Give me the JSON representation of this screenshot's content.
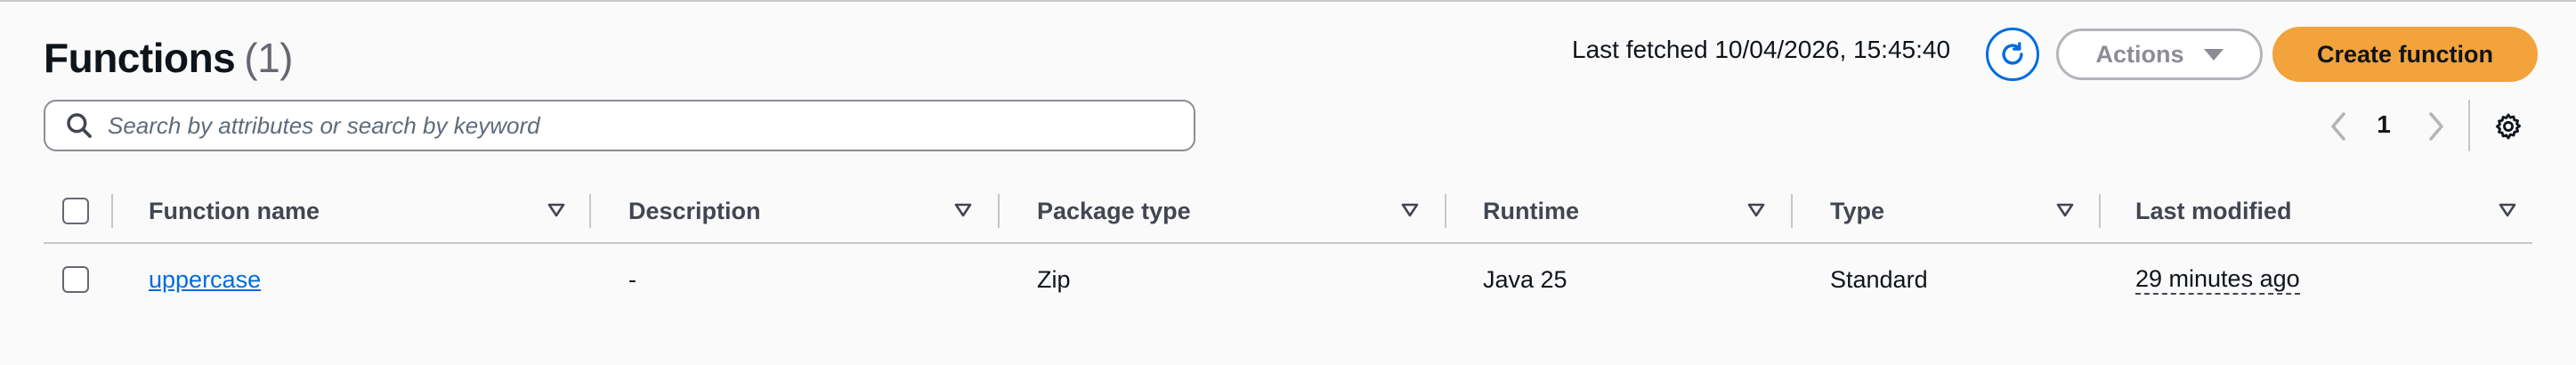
{
  "header": {
    "title": "Functions",
    "count": "(1)",
    "last_fetched": "Last fetched 10/04/2026, 15:45:40",
    "actions_label": "Actions",
    "create_label": "Create function"
  },
  "search": {
    "placeholder": "Search by attributes or search by keyword"
  },
  "pagination": {
    "current_page": "1"
  },
  "table": {
    "columns": [
      "Function name",
      "Description",
      "Package type",
      "Runtime",
      "Type",
      "Last modified"
    ],
    "rows": [
      {
        "function_name": "uppercase",
        "description": "-",
        "package_type": "Zip",
        "runtime": "Java 25",
        "type": "Standard",
        "last_modified": "29 minutes ago"
      }
    ]
  },
  "colors": {
    "accent": "#006ce0",
    "primary_button": "#f3a33b",
    "disabled": "#8c8c94"
  },
  "icons": [
    "refresh-icon",
    "caret-down-icon",
    "search-icon",
    "chevron-left-icon",
    "chevron-right-icon",
    "settings-gear-icon",
    "sort-caret-icon"
  ]
}
